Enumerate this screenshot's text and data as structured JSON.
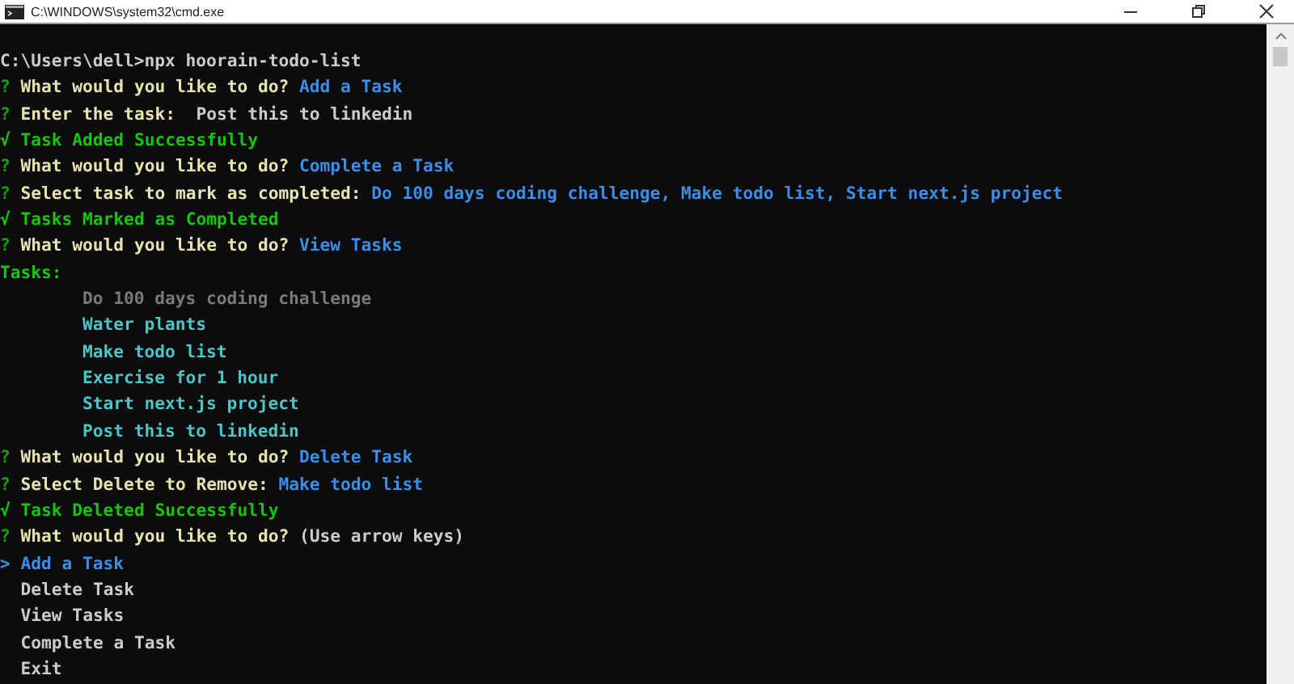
{
  "window": {
    "title": "C:\\WINDOWS\\system32\\cmd.exe"
  },
  "lines": [
    {
      "kind": "command",
      "text": "C:\\Users\\dell>npx hoorain-todo-list"
    },
    {
      "kind": "prompt",
      "mark": "?",
      "question": "What would you like to do?",
      "answer": "Add a Task"
    },
    {
      "kind": "prompt",
      "mark": "?",
      "question": "Enter the task:",
      "answer": "Post this to linkedin",
      "plain_answer": true
    },
    {
      "kind": "success",
      "mark": "√",
      "text": "Task Added Successfully"
    },
    {
      "kind": "prompt",
      "mark": "?",
      "question": "What would you like to do?",
      "answer": "Complete a Task"
    },
    {
      "kind": "prompt",
      "mark": "?",
      "question": "Select task to mark as completed:",
      "answer": "Do 100 days coding challenge, Make todo list, Start next.js project"
    },
    {
      "kind": "success",
      "mark": "√",
      "text": "Tasks Marked as Completed"
    },
    {
      "kind": "prompt",
      "mark": "?",
      "question": "What would you like to do?",
      "answer": "View Tasks"
    },
    {
      "kind": "heading",
      "text": "Tasks:"
    },
    {
      "kind": "task",
      "text": "Do 100 days coding challenge",
      "completed": true
    },
    {
      "kind": "task",
      "text": "Water plants",
      "completed": false
    },
    {
      "kind": "task",
      "text": "Make todo list",
      "completed": false
    },
    {
      "kind": "task",
      "text": "Exercise for 1 hour",
      "completed": false
    },
    {
      "kind": "task",
      "text": "Start next.js project",
      "completed": false
    },
    {
      "kind": "task",
      "text": "Post this to linkedin",
      "completed": false
    },
    {
      "kind": "prompt",
      "mark": "?",
      "question": "What would you like to do?",
      "answer": "Delete Task"
    },
    {
      "kind": "prompt",
      "mark": "?",
      "question": "Select Delete to Remove:",
      "answer": "Make todo list"
    },
    {
      "kind": "success",
      "mark": "√",
      "text": "Task Deleted Successfully"
    },
    {
      "kind": "prompt",
      "mark": "?",
      "question": "What would you like to do?",
      "hint": "(Use arrow keys)"
    },
    {
      "kind": "choice",
      "pointer": ">",
      "text": "Add a Task",
      "selected": true
    },
    {
      "kind": "choice",
      "text": "Delete Task",
      "selected": false
    },
    {
      "kind": "choice",
      "text": "View Tasks",
      "selected": false
    },
    {
      "kind": "choice",
      "text": "Complete a Task",
      "selected": false
    },
    {
      "kind": "choice",
      "text": "Exit",
      "selected": false
    }
  ]
}
